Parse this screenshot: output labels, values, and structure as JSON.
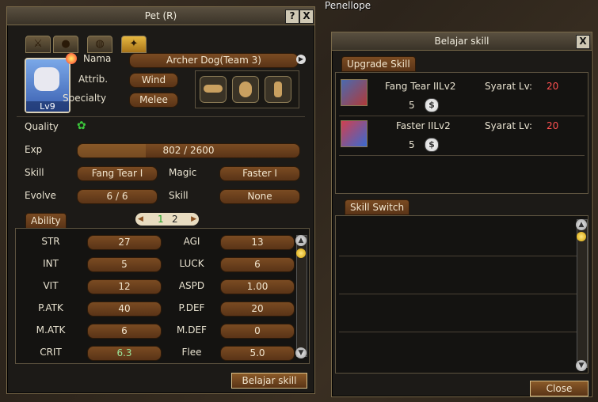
{
  "world": {
    "player_name": "Penellope"
  },
  "pet_window": {
    "title": "Pet (R)",
    "help_btn": "?",
    "close_btn": "X",
    "pet_level": "Lv9",
    "fields": {
      "nama_label": "Nama",
      "nama_value": "Archer Dog(Team 3)",
      "attrib_label": "Attrib.",
      "attrib_value": "Wind",
      "specialty_label": "Specialty",
      "specialty_value": "Melee",
      "quality_label": "Quality",
      "exp_label": "Exp",
      "exp_value": "802 / 2600",
      "exp_progress": 0.308,
      "skill_label": "Skill",
      "skill_value": "Fang Tear I",
      "magic_label": "Magic",
      "magic_value": "Faster I",
      "evolve_label": "Evolve",
      "evolve_value": "6 / 6",
      "skill2_label": "Skill",
      "skill2_value": "None"
    },
    "ability_tab": "Ability",
    "pages": [
      "1",
      "2"
    ],
    "stats": [
      {
        "l1": "STR",
        "v1": "27",
        "l2": "AGI",
        "v2": "13"
      },
      {
        "l1": "INT",
        "v1": "5",
        "l2": "LUCK",
        "v2": "6"
      },
      {
        "l1": "VIT",
        "v1": "12",
        "l2": "ASPD",
        "v2": "1.00"
      },
      {
        "l1": "P.ATK",
        "v1": "40",
        "l2": "P.DEF",
        "v2": "20"
      },
      {
        "l1": "M.ATK",
        "v1": "6",
        "l2": "M.DEF",
        "v2": "0"
      },
      {
        "l1": "CRIT",
        "v1": "6.3",
        "l2": "Flee",
        "v2": "5.0"
      }
    ],
    "learn_button": "Belajar skill"
  },
  "skill_window": {
    "title": "Belajar skill",
    "close_btn": "X",
    "upgrade_tab": "Upgrade Skill",
    "skills": [
      {
        "name": "Fang Tear IILv2",
        "req_label": "Syarat Lv:",
        "req_level": "20",
        "cost": "5"
      },
      {
        "name": "Faster IILv2",
        "req_label": "Syarat Lv:",
        "req_level": "20",
        "cost": "5"
      }
    ],
    "switch_tab": "Skill Switch",
    "close_button": "Close"
  },
  "colors": {
    "accent_gold": "#e6b840",
    "pill_brown": "#7a4b22",
    "required_red": "#ff5050"
  }
}
